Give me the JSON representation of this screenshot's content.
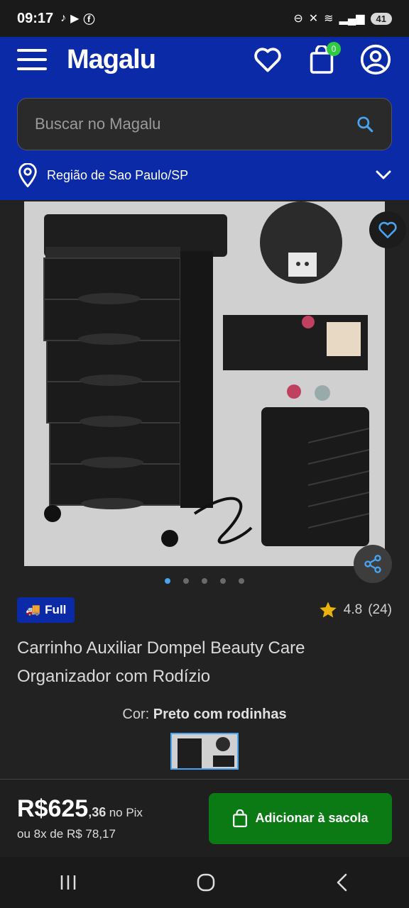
{
  "status": {
    "time": "09:17",
    "battery": "41"
  },
  "header": {
    "logo": "Magalu",
    "bag_count": "0"
  },
  "search": {
    "placeholder": "Buscar no Magalu"
  },
  "region": {
    "label": "Região de Sao Paulo/SP"
  },
  "gallery": {
    "dots": 5,
    "active_index": 0
  },
  "product": {
    "badge": "Full",
    "rating": "4.8",
    "reviews": "(24)",
    "title": "Carrinho Auxiliar Dompel Beauty Care Organizador com Rodízio",
    "color_label": "Cor:",
    "color_value": "Preto com rodinhas"
  },
  "price": {
    "main": "R$625",
    "cents": ",36",
    "pix_label": "no Pix",
    "installments": "ou 8x de R$ 78,17"
  },
  "cta": {
    "add_to_bag": "Adicionar à sacola"
  },
  "colors": {
    "brand_blue": "#0a2aa8",
    "cta_green": "#0b7a15",
    "badge_green": "#2ecc40",
    "dot_active": "#4aa3f0",
    "star": "#e8b30c"
  }
}
